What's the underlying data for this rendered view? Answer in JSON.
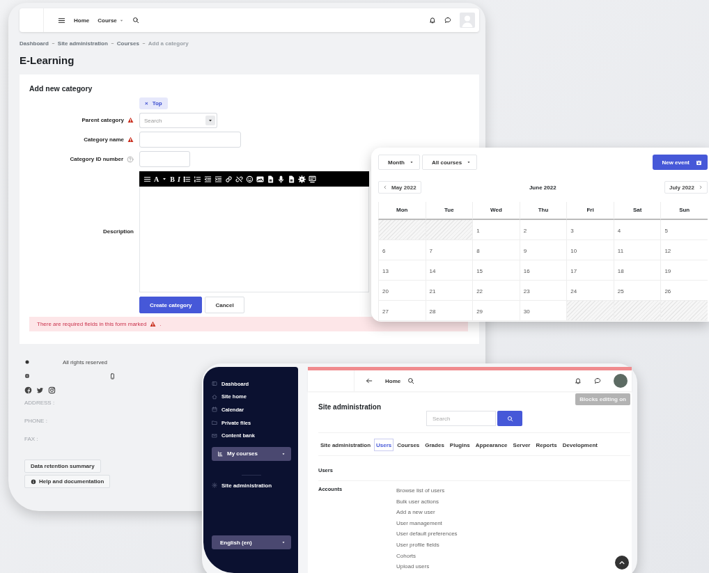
{
  "form_window": {
    "nav": {
      "links": [
        {
          "label": "Home",
          "dropdown": false
        },
        {
          "label": "Course",
          "dropdown": true
        }
      ]
    },
    "breadcrumb": [
      "Dashboard",
      "Site administration",
      "Courses",
      "Add a category"
    ],
    "site_title": "E-Learning",
    "form": {
      "title": "Add new category",
      "fields": [
        {
          "kind": "autocomplete",
          "label": "Parent category",
          "required": true,
          "help": false,
          "chip": "Top",
          "chip_remove": "×",
          "placeholder": "Search"
        },
        {
          "kind": "text",
          "label": "Category name",
          "required": true,
          "help": false
        },
        {
          "kind": "short_text",
          "label": "Category ID number",
          "required": false,
          "help": true
        },
        {
          "kind": "editor",
          "label": "Description",
          "required": false,
          "help": false,
          "toolbar_letters": [
            "A",
            "B",
            "I"
          ]
        }
      ],
      "buttons": [
        {
          "label": "Create category",
          "primary": true
        },
        {
          "label": "Cancel",
          "primary": false
        }
      ],
      "error": {
        "text": "There are required fields in this form marked",
        "suffix": "."
      }
    },
    "footer": {
      "rights": "All rights reserved",
      "contact": [
        "ADDRESS :",
        "PHONE :",
        "FAX :"
      ],
      "buttons": [
        {
          "label": "Data retention summary",
          "icon": false
        },
        {
          "label": "Help and documentation",
          "icon": true
        }
      ]
    }
  },
  "calendar_window": {
    "view_select": "Month",
    "course_select": "All courses",
    "new_event": "New event",
    "prev": "May 2022",
    "current": "June 2022",
    "next": "July 2022",
    "weekdays": [
      "Mon",
      "Tue",
      "Wed",
      "Thu",
      "Fri",
      "Sat",
      "Sun"
    ],
    "weeks": [
      [
        {
          "kind": "outside"
        },
        {
          "kind": "outside"
        },
        {
          "kind": "day",
          "day": "1"
        },
        {
          "kind": "day",
          "day": "2"
        },
        {
          "kind": "day",
          "day": "3"
        },
        {
          "kind": "day",
          "day": "4"
        },
        {
          "kind": "day",
          "day": "5"
        }
      ],
      [
        {
          "kind": "day",
          "day": "6"
        },
        {
          "kind": "day",
          "day": "7"
        },
        {
          "kind": "day",
          "day": "8"
        },
        {
          "kind": "day",
          "day": "9"
        },
        {
          "kind": "day",
          "day": "10"
        },
        {
          "kind": "day",
          "day": "11"
        },
        {
          "kind": "day",
          "day": "12"
        }
      ],
      [
        {
          "kind": "day",
          "day": "13"
        },
        {
          "kind": "day",
          "day": "14"
        },
        {
          "kind": "day",
          "day": "15"
        },
        {
          "kind": "day",
          "day": "16"
        },
        {
          "kind": "day",
          "day": "17"
        },
        {
          "kind": "day",
          "day": "18"
        },
        {
          "kind": "day",
          "day": "19"
        }
      ],
      [
        {
          "kind": "day",
          "day": "20"
        },
        {
          "kind": "day",
          "day": "21"
        },
        {
          "kind": "day",
          "day": "22"
        },
        {
          "kind": "day",
          "day": "23"
        },
        {
          "kind": "day",
          "day": "24"
        },
        {
          "kind": "day",
          "day": "25"
        },
        {
          "kind": "day",
          "day": "26"
        }
      ],
      [
        {
          "kind": "day",
          "day": "27"
        },
        {
          "kind": "day",
          "day": "28"
        },
        {
          "kind": "day",
          "day": "29"
        },
        {
          "kind": "day",
          "day": "30"
        },
        {
          "kind": "outside"
        },
        {
          "kind": "outside"
        },
        {
          "kind": "outside"
        }
      ]
    ]
  },
  "admin_window": {
    "sidebar": {
      "items": [
        {
          "kind": "link",
          "label": "Dashboard"
        },
        {
          "kind": "link",
          "label": "Site home"
        },
        {
          "kind": "link",
          "label": "Calendar"
        },
        {
          "kind": "link",
          "label": "Private files"
        },
        {
          "kind": "link",
          "label": "Content bank"
        },
        {
          "kind": "dropdown",
          "label": "My courses"
        },
        {
          "kind": "section",
          "label": "Site administration"
        }
      ],
      "language": "English (en)"
    },
    "nav": {
      "home": "Home"
    },
    "editing_button": "Blocks editing on",
    "title": "Site administration",
    "search_placeholder": "Search",
    "tabs": [
      {
        "label": "Site administration",
        "selected": false
      },
      {
        "label": "Users",
        "selected": true
      },
      {
        "label": "Courses",
        "selected": false
      },
      {
        "label": "Grades",
        "selected": false
      },
      {
        "label": "Plugins",
        "selected": false
      },
      {
        "label": "Appearance",
        "selected": false
      },
      {
        "label": "Server",
        "selected": false
      },
      {
        "label": "Reports",
        "selected": false
      },
      {
        "label": "Development",
        "selected": false
      }
    ],
    "section": "Users",
    "groups": [
      {
        "title": "Accounts",
        "links": [
          "Browse list of users",
          "Bulk user actions",
          "Add a new user",
          "User management",
          "User default preferences",
          "User profile fields",
          "Cohorts",
          "Upload users"
        ]
      }
    ]
  }
}
